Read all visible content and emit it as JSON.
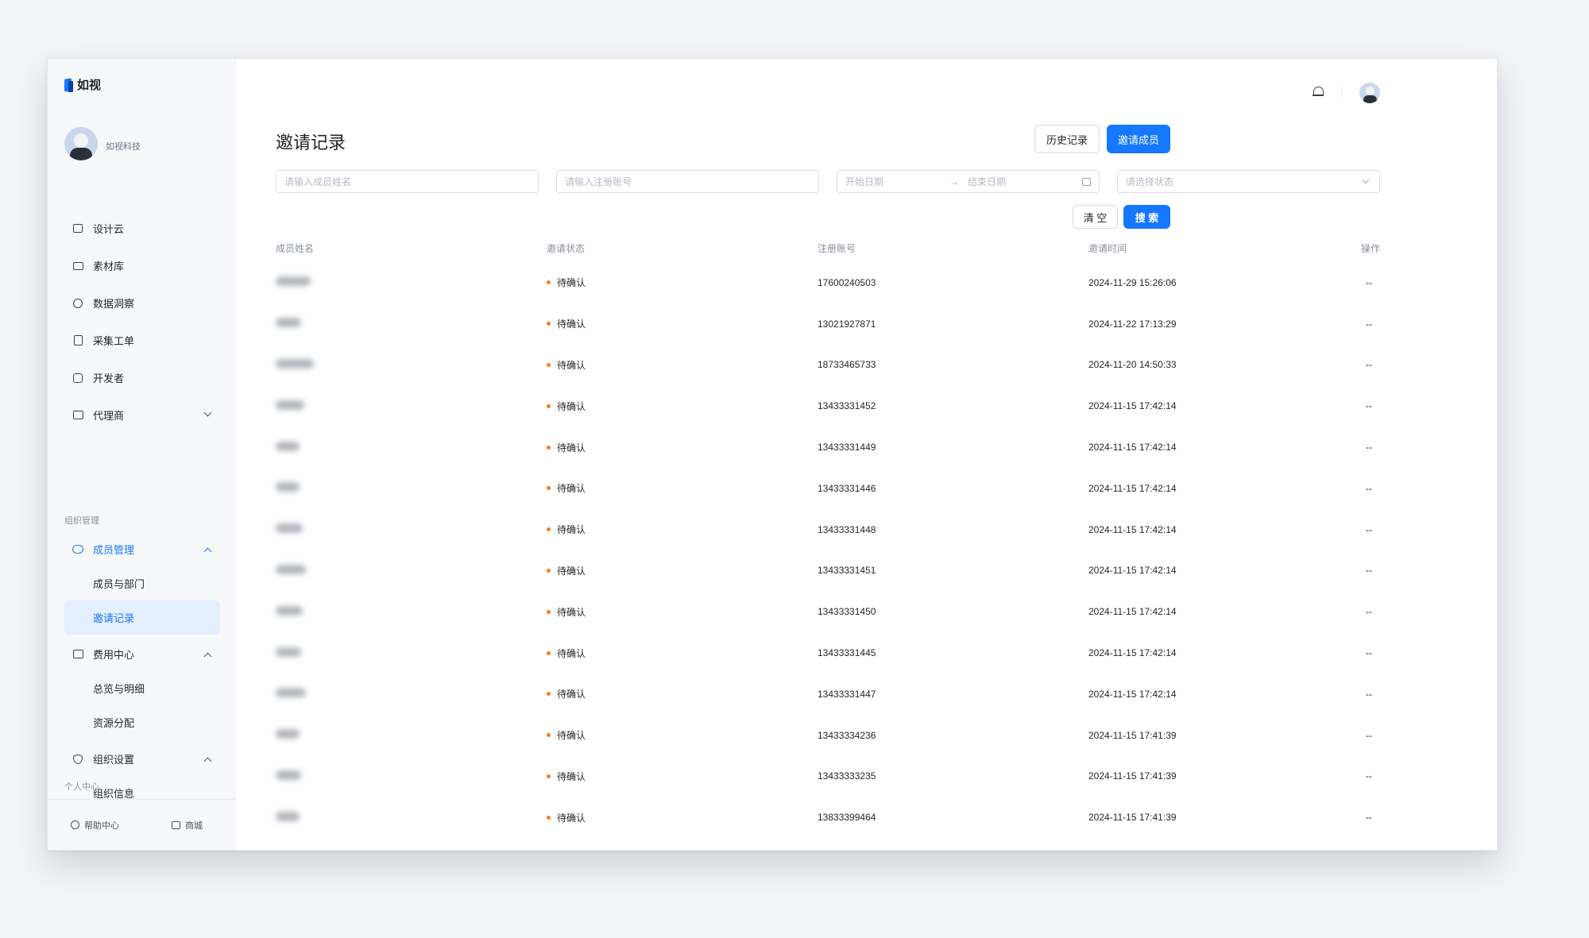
{
  "app": {
    "logo_text": "如视"
  },
  "profile": {
    "org_name": "如视科技"
  },
  "sidebar": {
    "items": [
      {
        "label": "设计云",
        "icon": "box-icon"
      },
      {
        "label": "素材库",
        "icon": "folder-icon"
      },
      {
        "label": "数据洞察",
        "icon": "pie-chart-icon"
      },
      {
        "label": "采集工单",
        "icon": "document-icon"
      },
      {
        "label": "开发者",
        "icon": "developer-icon"
      },
      {
        "label": "代理商",
        "icon": "briefcase-icon"
      }
    ],
    "section_org": "组织管理",
    "org_groups": [
      {
        "label": "成员管理",
        "icon": "team-icon",
        "children": [
          "成员与部门",
          "邀请记录"
        ]
      },
      {
        "label": "费用中心",
        "icon": "wallet-icon",
        "children": [
          "总览与明细",
          "资源分配"
        ]
      },
      {
        "label": "组织设置",
        "icon": "shield-icon",
        "children": [
          "组织信息"
        ]
      }
    ],
    "section_personal": "个人中心",
    "footer": {
      "help": "帮助中心",
      "shop": "商城"
    }
  },
  "header": {
    "page_title": "邀请记录",
    "history_button": "历史记录",
    "invite_button": "邀请成员"
  },
  "filters": {
    "name_placeholder": "请输入成员姓名",
    "account_placeholder": "请输入注册账号",
    "start_date_placeholder": "开始日期",
    "date_arrow": "→",
    "end_date_placeholder": "结束日期",
    "status_placeholder": "请选择状态",
    "clear_button": "清 空",
    "search_button": "搜 索"
  },
  "table": {
    "columns": [
      "成员姓名",
      "邀请状态",
      "注册账号",
      "邀请时间",
      "操作"
    ],
    "rows": [
      {
        "status": "待确认",
        "account": "17600240503",
        "time": "2024-11-29 15:26:06",
        "op": "--"
      },
      {
        "status": "待确认",
        "account": "13021927871",
        "time": "2024-11-22 17:13:29",
        "op": "--"
      },
      {
        "status": "待确认",
        "account": "18733465733",
        "time": "2024-11-20 14:50:33",
        "op": "--"
      },
      {
        "status": "待确认",
        "account": "13433331452",
        "time": "2024-11-15 17:42:14",
        "op": "--"
      },
      {
        "status": "待确认",
        "account": "13433331449",
        "time": "2024-11-15 17:42:14",
        "op": "--"
      },
      {
        "status": "待确认",
        "account": "13433331446",
        "time": "2024-11-15 17:42:14",
        "op": "--"
      },
      {
        "status": "待确认",
        "account": "13433331448",
        "time": "2024-11-15 17:42:14",
        "op": "--"
      },
      {
        "status": "待确认",
        "account": "13433331451",
        "time": "2024-11-15 17:42:14",
        "op": "--"
      },
      {
        "status": "待确认",
        "account": "13433331450",
        "time": "2024-11-15 17:42:14",
        "op": "--"
      },
      {
        "status": "待确认",
        "account": "13433331445",
        "time": "2024-11-15 17:42:14",
        "op": "--"
      },
      {
        "status": "待确认",
        "account": "13433331447",
        "time": "2024-11-15 17:42:14",
        "op": "--"
      },
      {
        "status": "待确认",
        "account": "13433334236",
        "time": "2024-11-15 17:41:39",
        "op": "--"
      },
      {
        "status": "待确认",
        "account": "13433333235",
        "time": "2024-11-15 17:41:39",
        "op": "--"
      },
      {
        "status": "待确认",
        "account": "13833399464",
        "time": "2024-11-15 17:41:39",
        "op": "--"
      }
    ]
  },
  "colors": {
    "accent": "#1677ff",
    "pending_dot": "#ff7a1a",
    "active_bg": "#e3eefe"
  }
}
